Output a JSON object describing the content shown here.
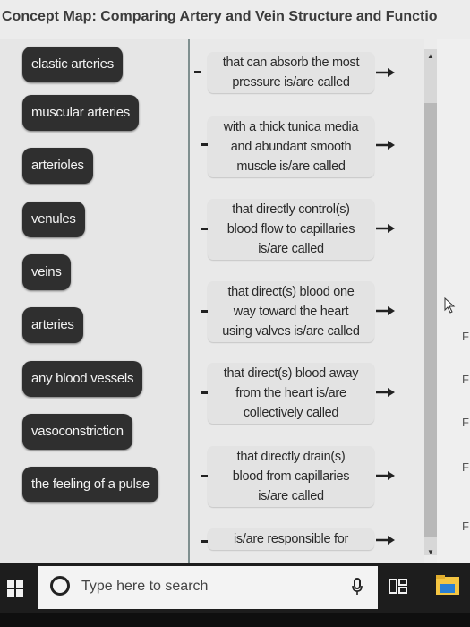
{
  "title": "Concept Map: Comparing Artery and Vein Structure and Functio",
  "terms": [
    "elastic arteries",
    "muscular arteries",
    "arterioles",
    "venules",
    "veins",
    "arteries",
    "any blood vessels",
    "vasoconstriction",
    "the feeling of a pulse"
  ],
  "phrases": [
    [
      "that can absorb the most",
      "pressure is/are called"
    ],
    [
      "with a thick tunica media",
      "and abundant smooth",
      "muscle is/are called"
    ],
    [
      "that directly control(s)",
      "blood flow to capillaries",
      "is/are called"
    ],
    [
      "that direct(s) blood one",
      "way toward the heart",
      "using valves is/are called"
    ],
    [
      "that direct(s) blood away",
      "from the heart is/are",
      "collectively called"
    ],
    [
      "that directly drain(s)",
      "blood from capillaries",
      "is/are called"
    ],
    [
      "is/are responsible for"
    ]
  ],
  "right_edge_letters": [
    "F",
    "F",
    "F",
    "F",
    "F"
  ],
  "taskbar": {
    "search_placeholder": "Type here to search",
    "start_icon": "windows-logo-icon",
    "search_icon": "cortana-ring-icon",
    "mic_icon": "microphone-icon",
    "taskview_icon": "task-view-icon",
    "explorer_icon": "file-explorer-icon"
  },
  "colors": {
    "term_bg": "#2f2f2f",
    "term_text": "#f2f2f2",
    "phrase_bg": "#e3e3e3",
    "taskbar_bg": "#1d1d1d",
    "explorer_yellow": "#f4c542",
    "explorer_blue": "#2a7fd4"
  }
}
